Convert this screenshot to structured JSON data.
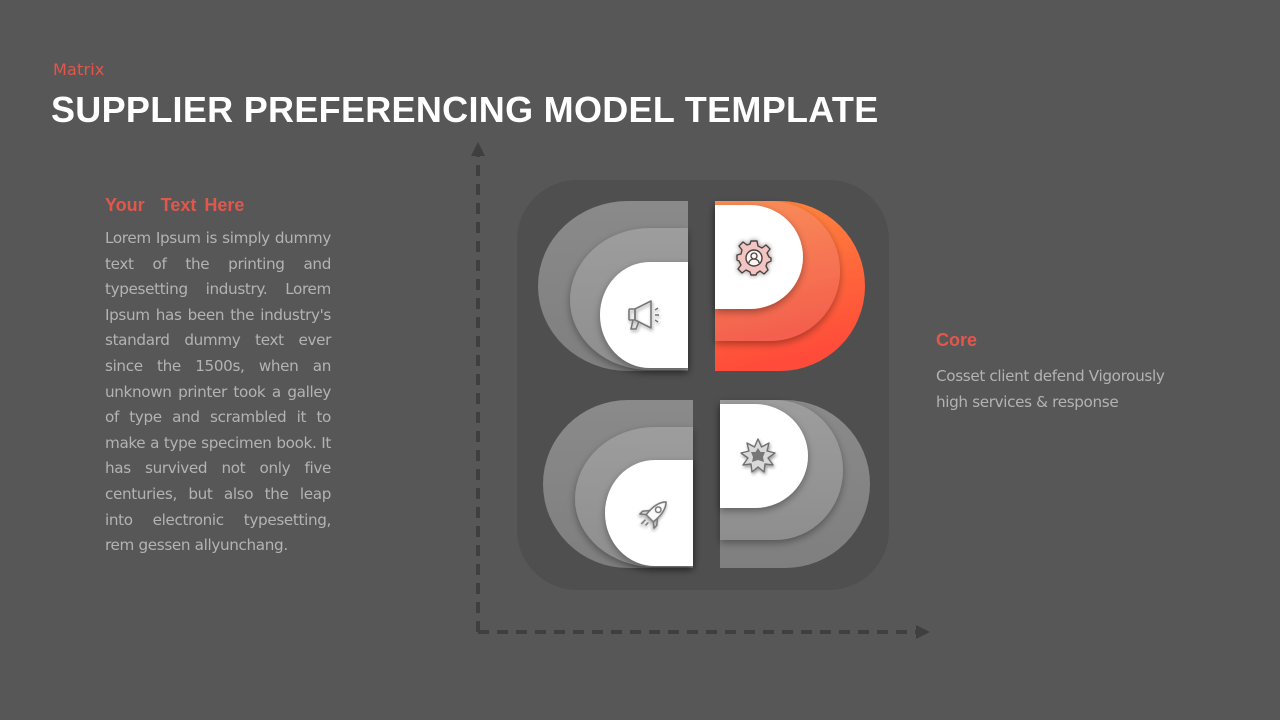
{
  "header": {
    "eyebrow": "Matrix",
    "title": "SUPPLIER PREFERENCING MODEL TEMPLATE"
  },
  "left_panel": {
    "heading": "Your  Text Here",
    "body": "Lorem Ipsum is simply dummy text of the printing and typesetting industry. Lorem Ipsum has been the industry's standard dummy text ever since the 1500s, when an unknown printer took a galley of type and scrambled it to make a type specimen book. It has survived not only five centuries, but also the leap into electronic typesetting, rem gessen allyunchang."
  },
  "right_panel": {
    "heading": "Core",
    "body": "Cosset client defend Vigorously high services & response"
  },
  "matrix": {
    "quadrants": [
      {
        "id": "top-left",
        "icon": "megaphone-icon",
        "highlighted": false
      },
      {
        "id": "top-right",
        "icon": "gear-person-icon",
        "highlighted": true
      },
      {
        "id": "bottom-left",
        "icon": "rocket-icon",
        "highlighted": false
      },
      {
        "id": "bottom-right",
        "icon": "starburst-icon",
        "highlighted": false
      }
    ],
    "colors": {
      "accent_start": "#ff8a3d",
      "accent_end": "#ff4b3a",
      "gray_outer": "#858585",
      "gray_mid": "#9a9a9a",
      "inner": "#ffffff",
      "backdrop": "#4f4f4f",
      "axis": "#3f3f3f"
    }
  }
}
